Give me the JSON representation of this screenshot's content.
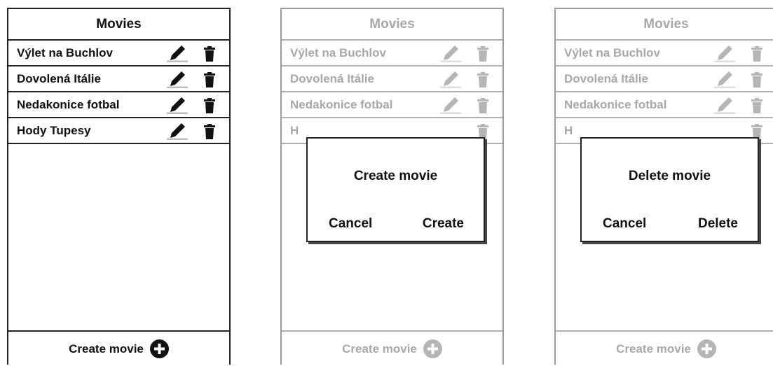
{
  "screens": [
    {
      "title": "Movies",
      "items": [
        {
          "label": "Výlet na Buchlov"
        },
        {
          "label": "Dovolená Itálie"
        },
        {
          "label": "Nedakonice fotbal"
        },
        {
          "label": "Hody Tupesy"
        }
      ],
      "footer_label": "Create movie"
    },
    {
      "title": "Movies",
      "items": [
        {
          "label": "Výlet na Buchlov"
        },
        {
          "label": "Dovolená Itálie"
        },
        {
          "label": "Nedakonice fotbal"
        },
        {
          "label": "H"
        }
      ],
      "footer_label": "Create movie",
      "dialog": {
        "title": "Create movie",
        "cancel_label": "Cancel",
        "confirm_label": "Create"
      }
    },
    {
      "title": "Movies",
      "items": [
        {
          "label": "Výlet na Buchlov"
        },
        {
          "label": "Dovolená Itálie"
        },
        {
          "label": "Nedakonice fotbal"
        },
        {
          "label": "H"
        }
      ],
      "footer_label": "Create movie",
      "dialog": {
        "title": "Delete movie",
        "cancel_label": "Cancel",
        "confirm_label": "Delete"
      }
    }
  ],
  "icons": {
    "edit": "pencil-icon",
    "delete": "trash-icon",
    "add": "plus-circle-icon"
  },
  "colors": {
    "foreground": "#111111",
    "dimmed": "#a8a8a8",
    "border": "#222222"
  }
}
